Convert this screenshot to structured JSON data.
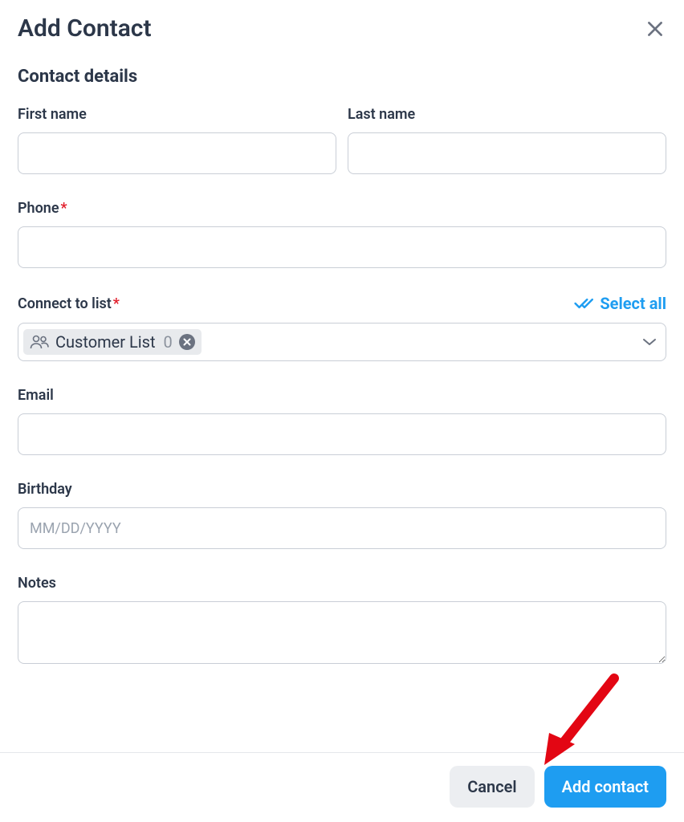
{
  "modal": {
    "title": "Add Contact",
    "section_title": "Contact details"
  },
  "fields": {
    "first_name": {
      "label": "First name",
      "value": ""
    },
    "last_name": {
      "label": "Last name",
      "value": ""
    },
    "phone": {
      "label": "Phone",
      "value": ""
    },
    "connect_list": {
      "label": "Connect to list",
      "select_all": "Select all",
      "selected_chip": {
        "name": "Customer List",
        "count": "0"
      }
    },
    "email": {
      "label": "Email",
      "value": ""
    },
    "birthday": {
      "label": "Birthday",
      "placeholder": "MM/DD/YYYY",
      "value": ""
    },
    "notes": {
      "label": "Notes",
      "value": ""
    }
  },
  "footer": {
    "cancel": "Cancel",
    "submit": "Add contact"
  }
}
